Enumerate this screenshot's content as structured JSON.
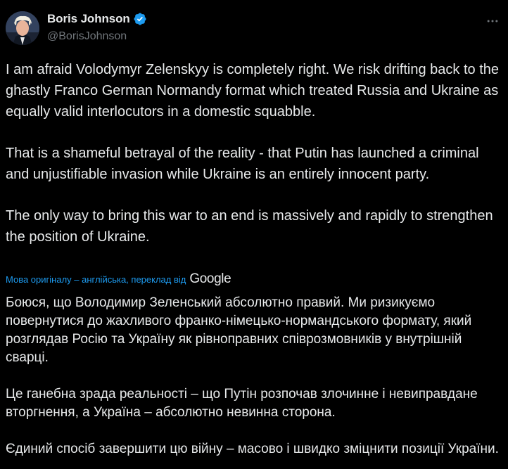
{
  "author": {
    "display_name": "Boris Johnson",
    "handle": "@BorisJohnson",
    "verified_icon": "verified-badge-icon",
    "avatar_icon": "profile-avatar"
  },
  "tweet": {
    "paragraphs": [
      "I am afraid Volodymyr Zelenskyy is completely right. We risk drifting back to the ghastly Franco German Normandy format which treated Russia and Ukraine as equally valid interlocutors in a domestic squabble.",
      "That is a shameful betrayal of the reality - that Putin has launched a criminal and unjustifiable invasion while Ukraine is an entirely innocent party.",
      "The only way to bring this war to an end is massively and rapidly to strengthen the position of Ukraine."
    ]
  },
  "translation": {
    "label": "Мова оригіналу – англійська, переклад від",
    "provider": "Google",
    "paragraphs": [
      "Боюся, що Володимир Зеленський абсолютно правий. Ми ризикуємо повернутися до жахливого франко-німецько-нормандського формату, який розглядав Росію та Україну як рівноправних співрозмовників у внутрішній сварці.",
      "Це ганебна зрада реальності – що Путін розпочав злочинне і невиправдане вторгнення, а Україна – абсолютно невинна сторона.",
      "Єдиний спосіб завершити цю війну – масово і швидко зміцнити позиції України."
    ]
  },
  "colors": {
    "background": "#000000",
    "text": "#e7e9ea",
    "secondary_text": "#71767b",
    "link": "#1d9bf0",
    "verified": "#1d9bf0"
  },
  "icons": {
    "more": "more-options-icon"
  }
}
